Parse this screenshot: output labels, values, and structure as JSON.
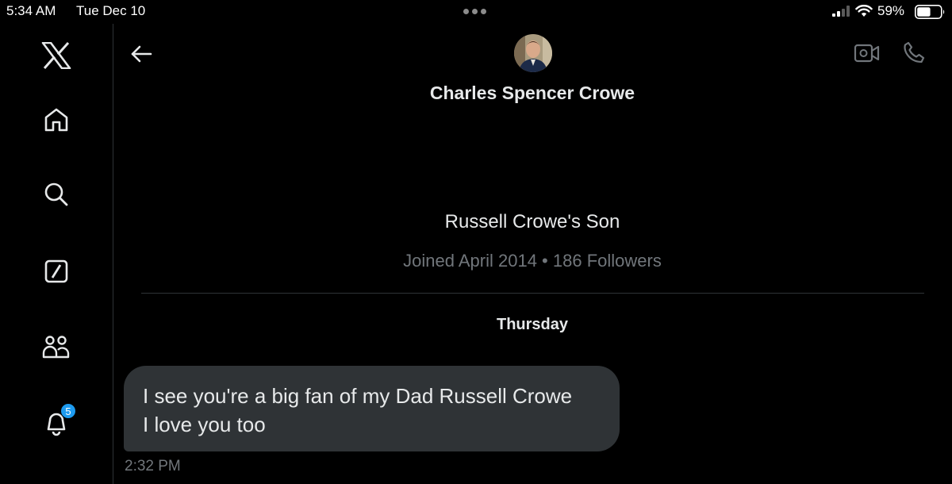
{
  "status_bar": {
    "time": "5:34 AM",
    "date": "Tue Dec 10",
    "battery_percent": "59%",
    "battery_level": 0.59,
    "icons": [
      "multitask-dots-icon",
      "signal-icon",
      "wifi-icon",
      "battery-icon"
    ]
  },
  "sidebar": {
    "items": [
      {
        "icon": "x-logo-icon"
      },
      {
        "icon": "home-icon"
      },
      {
        "icon": "search-icon"
      },
      {
        "icon": "grok-icon"
      },
      {
        "icon": "communities-icon"
      },
      {
        "icon": "bell-icon",
        "badge": "5"
      }
    ]
  },
  "header": {
    "name": "Charles Spencer Crowe",
    "icons": [
      "back-arrow-icon",
      "video-call-icon",
      "phone-icon"
    ]
  },
  "profile": {
    "bio": "Russell Crowe's Son",
    "joined": "Joined April 2014 • 186 Followers"
  },
  "conversation": {
    "day": "Thursday",
    "messages": [
      {
        "lines": [
          "I see you're a big fan of my Dad Russell Crowe",
          "I love you too"
        ],
        "time": "2:32 PM"
      }
    ]
  },
  "colors": {
    "background": "#000000",
    "text": "#e7e9ea",
    "muted": "#71767b",
    "bubble": "#2f3336",
    "accent": "#1d9bf0"
  }
}
